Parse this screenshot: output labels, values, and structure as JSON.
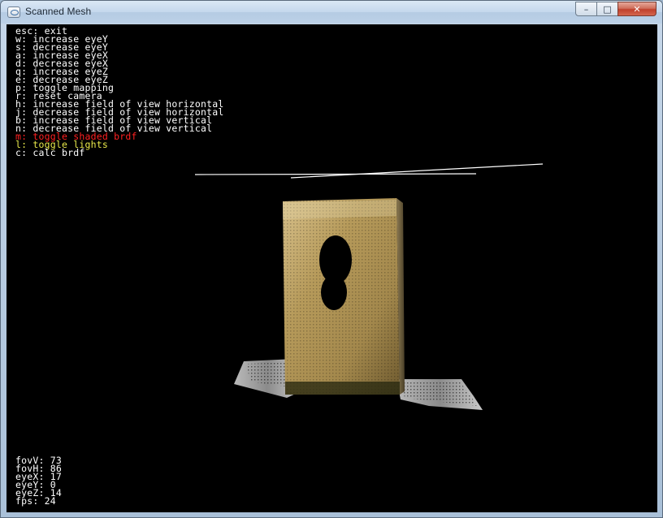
{
  "window": {
    "title": "Scanned Mesh",
    "controls": {
      "minimize": "–",
      "maximize": "□",
      "close": "✕"
    }
  },
  "help": {
    "lines": [
      "esc: exit",
      "w: increase eyeY",
      "s: decrease eyeY",
      "a: increase eyeX",
      "d: decrease eyeX",
      "q: increase eyeZ",
      "e: decrease eyeZ",
      "p: toggle mapping",
      "r: reset camera",
      "h: increase field of view horizontal",
      "j: decrease field of view horizontal",
      "b: increase field of view vertical",
      "n: decrease field of view vertical",
      "m: toggle shaded brdf",
      "l: toggle lights",
      "c: calc brdf"
    ],
    "line_colors": {
      "m: toggle shaded brdf": "#ff2020",
      "l: toggle lights": "#e8e84a"
    }
  },
  "status": {
    "lines": [
      "fovV: 73",
      "fovH: 86",
      "eyeX: 17",
      "eyeY: 0",
      "eyeZ: 14",
      "fps: 24"
    ]
  },
  "colors": {
    "background": "#000000",
    "text": "#ffffff",
    "highlight_red": "#ff2020",
    "highlight_yellow": "#e8e84a",
    "mesh_base": "#b59a5a"
  }
}
